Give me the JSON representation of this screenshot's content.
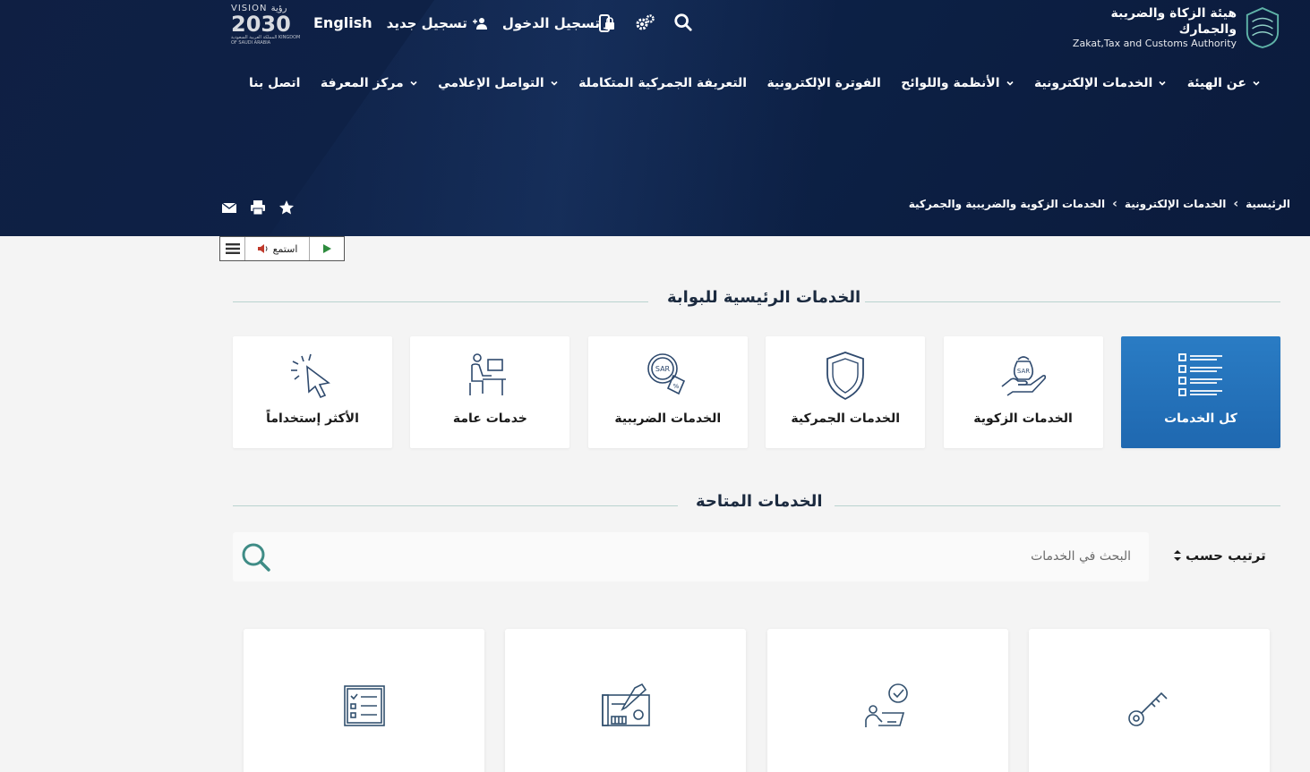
{
  "header": {
    "logo_ar": "هيئة الزكاة والضريبة والجمارك",
    "logo_en": "Zakat,Tax and Customs Authority",
    "vision": {
      "top": "VISION رؤية",
      "year": "2030",
      "sub": "المملكة العربية السعودية KINGDOM OF SAUDI ARABIA"
    },
    "login": "تسجيل الدخول",
    "register": "تسجيل جديد",
    "language": "English"
  },
  "nav": [
    {
      "label": "عن الهيئة",
      "dropdown": true
    },
    {
      "label": "الخدمات الإلكترونية",
      "dropdown": true
    },
    {
      "label": "الأنظمة واللوائح",
      "dropdown": true
    },
    {
      "label": "الفوترة الإلكترونية",
      "dropdown": false
    },
    {
      "label": "التعريفة الجمركية المتكاملة",
      "dropdown": false
    },
    {
      "label": "التواصل الإعلامي",
      "dropdown": true
    },
    {
      "label": "مركز المعرفة",
      "dropdown": true
    },
    {
      "label": "اتصل بنا",
      "dropdown": false
    }
  ],
  "breadcrumb": [
    "الرئيسية",
    "الخدمات الإلكترونية",
    "الخدمات الزكوية والضريبية والجمركية"
  ],
  "listen": {
    "label": "استمع"
  },
  "main_services_title": "الخدمات الرئيسية للبوابة",
  "categories": [
    {
      "label": "كل الخدمات",
      "icon": "list-icon",
      "active": true
    },
    {
      "label": "الخدمات الزكوية",
      "icon": "zakat-hand-icon",
      "active": false
    },
    {
      "label": "الخدمات الجمركية",
      "icon": "shield-icon",
      "active": false
    },
    {
      "label": "الخدمات الضريبية",
      "icon": "tax-icon",
      "active": false
    },
    {
      "label": "خدمات عامة",
      "icon": "person-desk-icon",
      "active": false
    },
    {
      "label": "الأكثر إستخداماً",
      "icon": "cursor-click-icon",
      "active": false
    }
  ],
  "available_title": "الخدمات المتاحة",
  "sort_label": "ترتيب حسب",
  "search": {
    "placeholder": "البحث في الخدمات"
  },
  "service_cards": [
    {
      "icon": "key-icon"
    },
    {
      "icon": "person-check-icon"
    },
    {
      "icon": "certificate-icon"
    },
    {
      "icon": "checklist-icon"
    }
  ],
  "colors": {
    "header_bg": "#0d2248",
    "accent_blue": "#2172b9",
    "teal": "#3f8c86"
  }
}
